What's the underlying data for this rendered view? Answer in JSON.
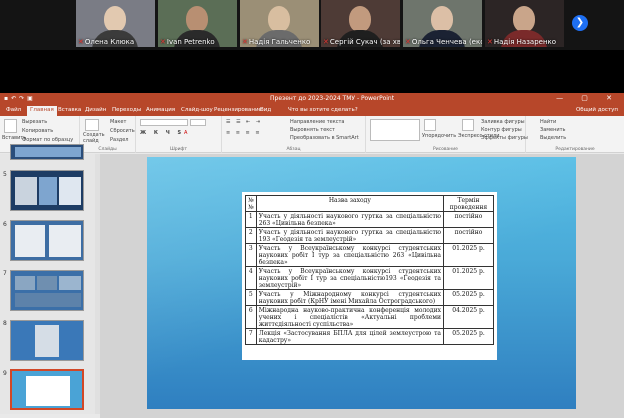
{
  "participants": [
    {
      "name": "Олена Клюка",
      "bg": "#7a7c85"
    },
    {
      "name": "Ivan Petrenko",
      "bg": "#5b6e56"
    },
    {
      "name": "Надія Гальченко",
      "bg": "#9b8f76"
    },
    {
      "name": "Сергій Сукач (за хвил...",
      "bg": "#4e3b36"
    },
    {
      "name": "Ольга Ченчева (експерт)",
      "bg": "#6e756c"
    },
    {
      "name": "Надія Назаренко",
      "bg": "#2c2525"
    }
  ],
  "window": {
    "title": "Презент до 2023-2024 ТМУ  -  PowerPoint"
  },
  "tabs": [
    "Файл",
    "Главная",
    "Вставка",
    "Дизайн",
    "Переходы",
    "Анимация",
    "Слайд-шоу",
    "Рецензирование",
    "Вид",
    "Что вы хотите сделать?"
  ],
  "tabs_right": "Общий доступ",
  "ribbon": {
    "paste": "Вставить",
    "cut": "Вырезать",
    "copy": "Копировать",
    "format_painter": "Формат по образцу",
    "clipboard": "Буфер обмена",
    "new_slide": "Создать слайд",
    "layout": "Макет",
    "reset": "Сбросить",
    "section": "Раздел",
    "slides": "Слайды",
    "font": "Шрифт",
    "text_direction": "Направление текста",
    "align_text": "Выровнять текст",
    "smartart": "Преобразовать в SmartArt",
    "paragraph": "Абзац",
    "drawing": "Рисование",
    "arrange": "Упорядочить",
    "quick_styles": "Экспресс-стили",
    "shape_fill": "Заливка фигуры",
    "shape_outline": "Контур фигуры",
    "shape_effects": "Эффекты фигуры",
    "find": "Найти",
    "replace": "Заменить",
    "select": "Выделить",
    "editing": "Редактирование"
  },
  "thumbnails": [
    {
      "num": ""
    },
    {
      "num": "5"
    },
    {
      "num": "6"
    },
    {
      "num": "7"
    },
    {
      "num": "8"
    },
    {
      "num": "9"
    }
  ],
  "slide_table": {
    "headers": [
      "№ №",
      "Назва заходу",
      "Термін проведення"
    ],
    "rows": [
      {
        "n": "1",
        "desc": "Участь у діяльності наукового гуртка за спеціальністю 263 «Цивільна безпека»",
        "term": "постійно"
      },
      {
        "n": "2",
        "desc": "Участь у діяльності наукового гуртка за спеціальністю 193 «Геодезія та землеустрій»",
        "term": "постійно"
      },
      {
        "n": "3",
        "desc": "Участь у Всеукраїнському конкурсі студентських наукових робіт І тур за спеціальністю 263 «Цивільна безпека»",
        "term": "01.2025 р."
      },
      {
        "n": "4",
        "desc": "Участь у Всеукраїнському конкурсі студентських наукових робіт І тур за спеціальністю193 «Геодезія та землеустрій»",
        "term": "01.2025 р."
      },
      {
        "n": "5",
        "desc": "Участь у Міжнародному конкурсі студентських наукових робіт (КрНУ імені Михайла Остроградського)",
        "term": "05.2025 р."
      },
      {
        "n": "6",
        "desc": "Міжнародна науково-практична конференція молодих учених і спеціалістів «Актуальні проблеми життєдіяльності суспільства»",
        "term": "04.2025 р."
      },
      {
        "n": "7",
        "desc": "Лекція «Застосування БПЛА для цілей землеустрою та кадастру»",
        "term": "05.2025 р."
      }
    ]
  }
}
